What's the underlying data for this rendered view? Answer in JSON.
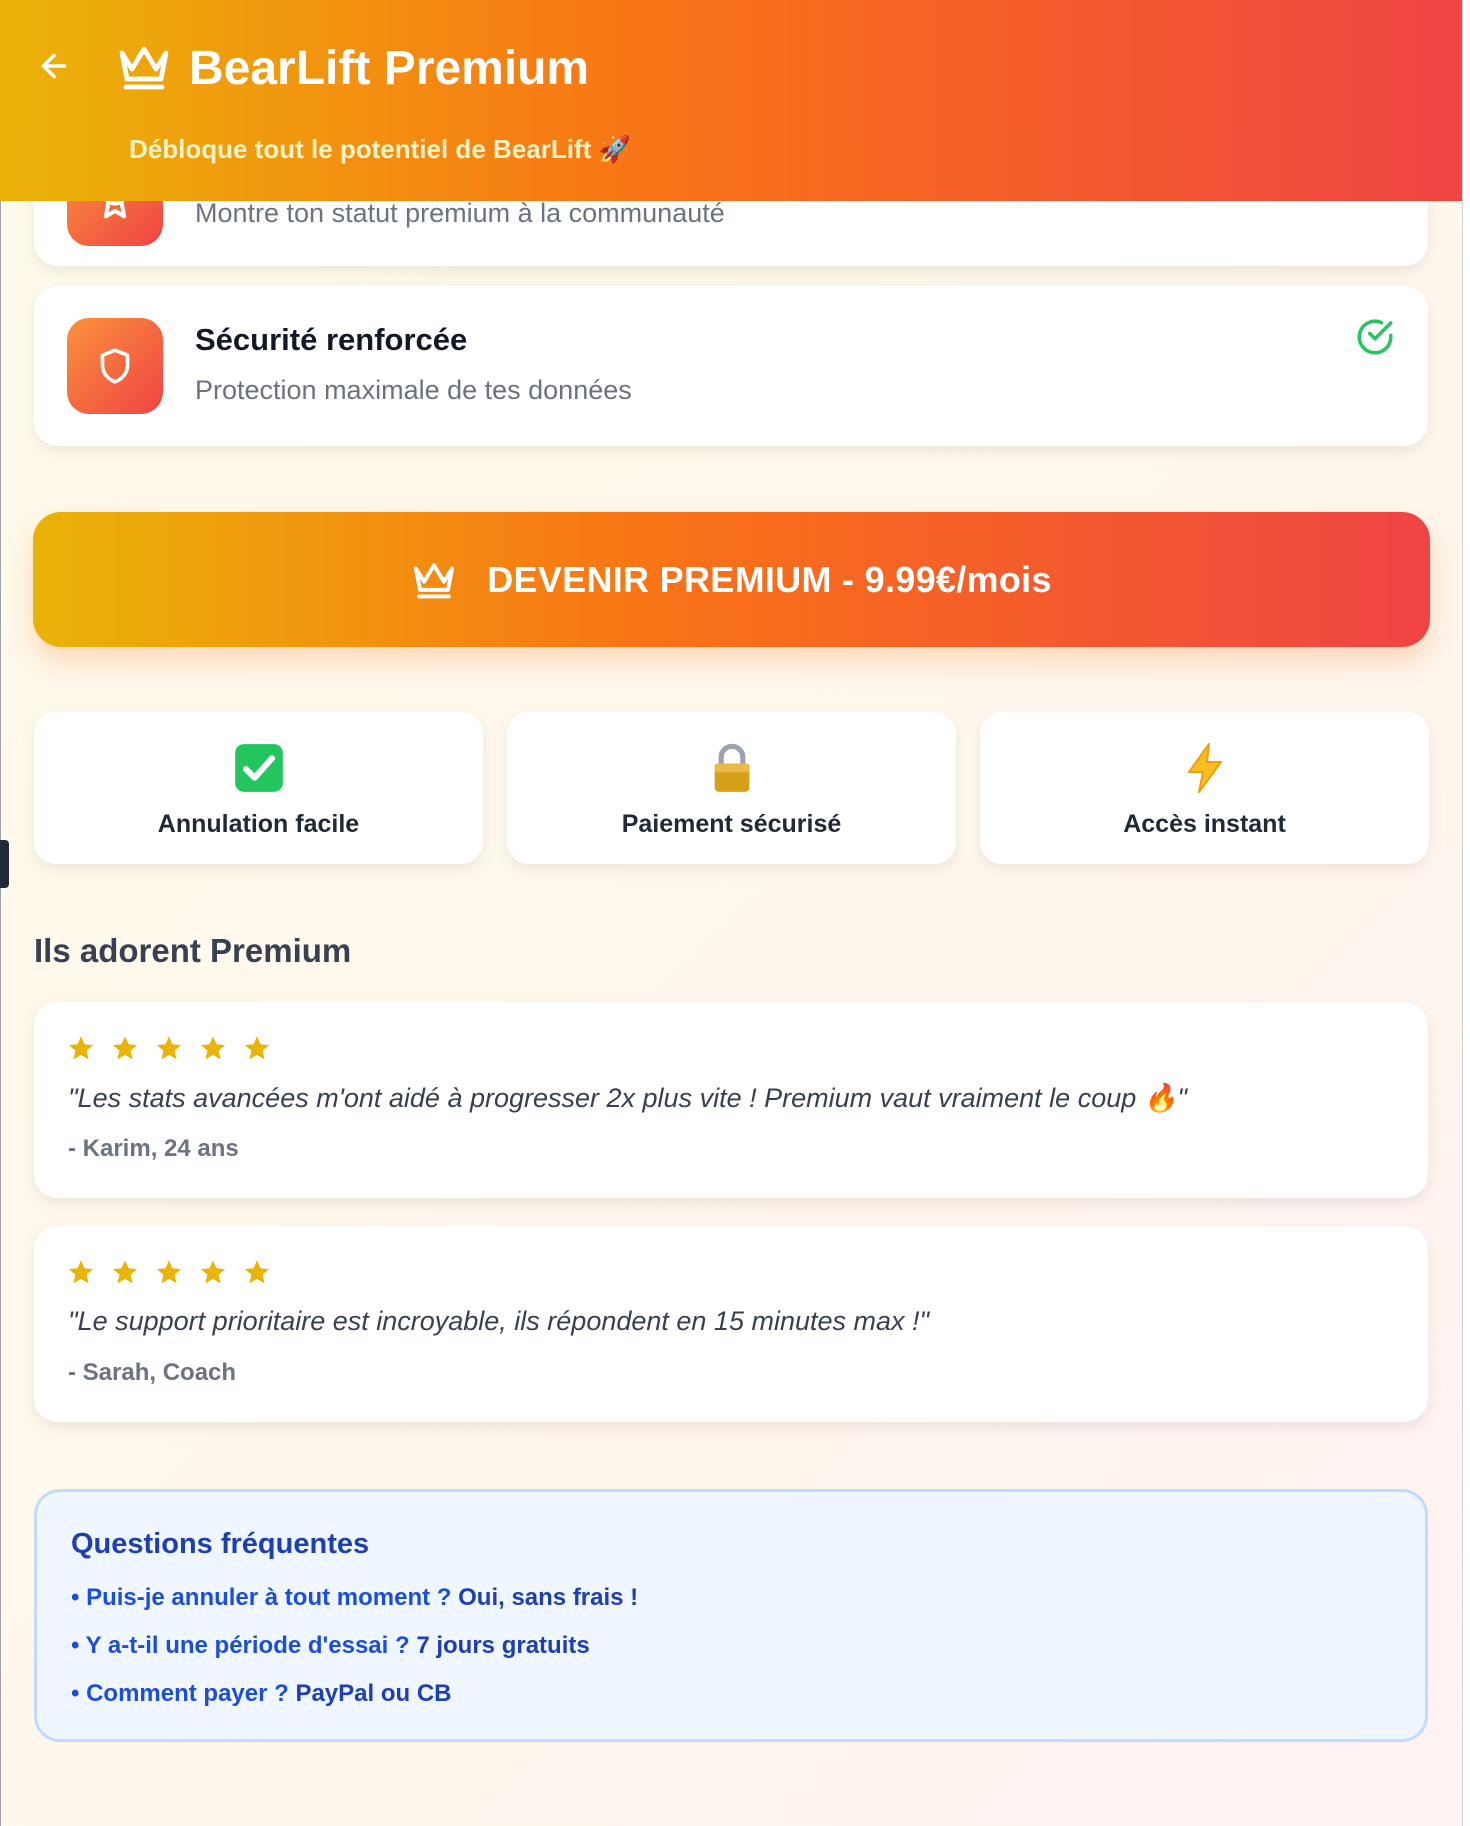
{
  "header": {
    "title": "BearLift Premium",
    "subtitle": "Débloque tout le potentiel de BearLift 🚀",
    "colors": {
      "start": "#eab308",
      "mid": "#f97316",
      "end": "#ef4444"
    }
  },
  "features": [
    {
      "desc": "Montre ton statut premium à la communauté",
      "icon": "badge-icon"
    },
    {
      "title": "Sécurité renforcée",
      "desc": "Protection maximale de tes données",
      "icon": "shield-icon",
      "checked": true
    }
  ],
  "cta": {
    "label": "DEVENIR PREMIUM - 9.99€/mois"
  },
  "trust": [
    {
      "icon": "✅",
      "label": "Annulation facile"
    },
    {
      "icon": "🔒",
      "label": "Paiement sécurisé"
    },
    {
      "icon": "⚡",
      "label": "Accès instant"
    }
  ],
  "testimonials": {
    "title": "Ils adorent Premium",
    "items": [
      {
        "rating": 5,
        "quote": "\"Les stats avancées m'ont aidé à progresser 2x plus vite ! Premium vaut vraiment le coup 🔥\"",
        "author": "- Karim, 24 ans"
      },
      {
        "rating": 5,
        "quote": "\"Le support prioritaire est incroyable, ils répondent en 15 minutes max !\"",
        "author": "- Sarah, Coach"
      }
    ]
  },
  "faq": {
    "title": "Questions fréquentes",
    "items": [
      {
        "q": "• Puis-je annuler à tout moment ? ",
        "a": "Oui, sans frais !"
      },
      {
        "q": "• Y a-t-il une période d'essai ? ",
        "a": "7 jours gratuits"
      },
      {
        "q": "• Comment payer ? ",
        "a": "PayPal ou CB"
      }
    ]
  }
}
